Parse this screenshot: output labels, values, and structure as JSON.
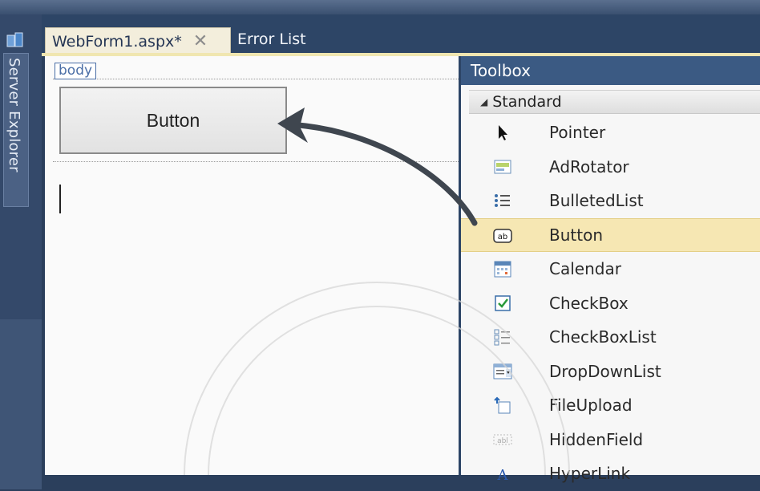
{
  "tabs": {
    "active_label": "WebForm1.aspx*",
    "close_glyph": "✕",
    "inactive_label": "Error List"
  },
  "left_rail": {
    "server_explorer_label": "Server Explorer"
  },
  "design_surface": {
    "body_tag": "body",
    "button_text": "Button"
  },
  "toolbox": {
    "title": "Toolbox",
    "group_label": "Standard",
    "items": [
      {
        "label": "Pointer",
        "icon": "pointer-icon"
      },
      {
        "label": "AdRotator",
        "icon": "adrotator-icon"
      },
      {
        "label": "BulletedList",
        "icon": "bulletedlist-icon"
      },
      {
        "label": "Button",
        "icon": "button-icon"
      },
      {
        "label": "Calendar",
        "icon": "calendar-icon"
      },
      {
        "label": "CheckBox",
        "icon": "checkbox-icon"
      },
      {
        "label": "CheckBoxList",
        "icon": "checkboxlist-icon"
      },
      {
        "label": "DropDownList",
        "icon": "dropdownlist-icon"
      },
      {
        "label": "FileUpload",
        "icon": "fileupload-icon"
      },
      {
        "label": "HiddenField",
        "icon": "hiddenfield-icon"
      },
      {
        "label": "HyperLink",
        "icon": "hyperlink-icon"
      }
    ],
    "selected_item": "Button"
  },
  "colors": {
    "chrome_dark": "#2b3f5c",
    "toolbox_header": "#3b5a83",
    "selected_highlight": "#f6e7b3",
    "active_tab": "#f3eedc"
  }
}
